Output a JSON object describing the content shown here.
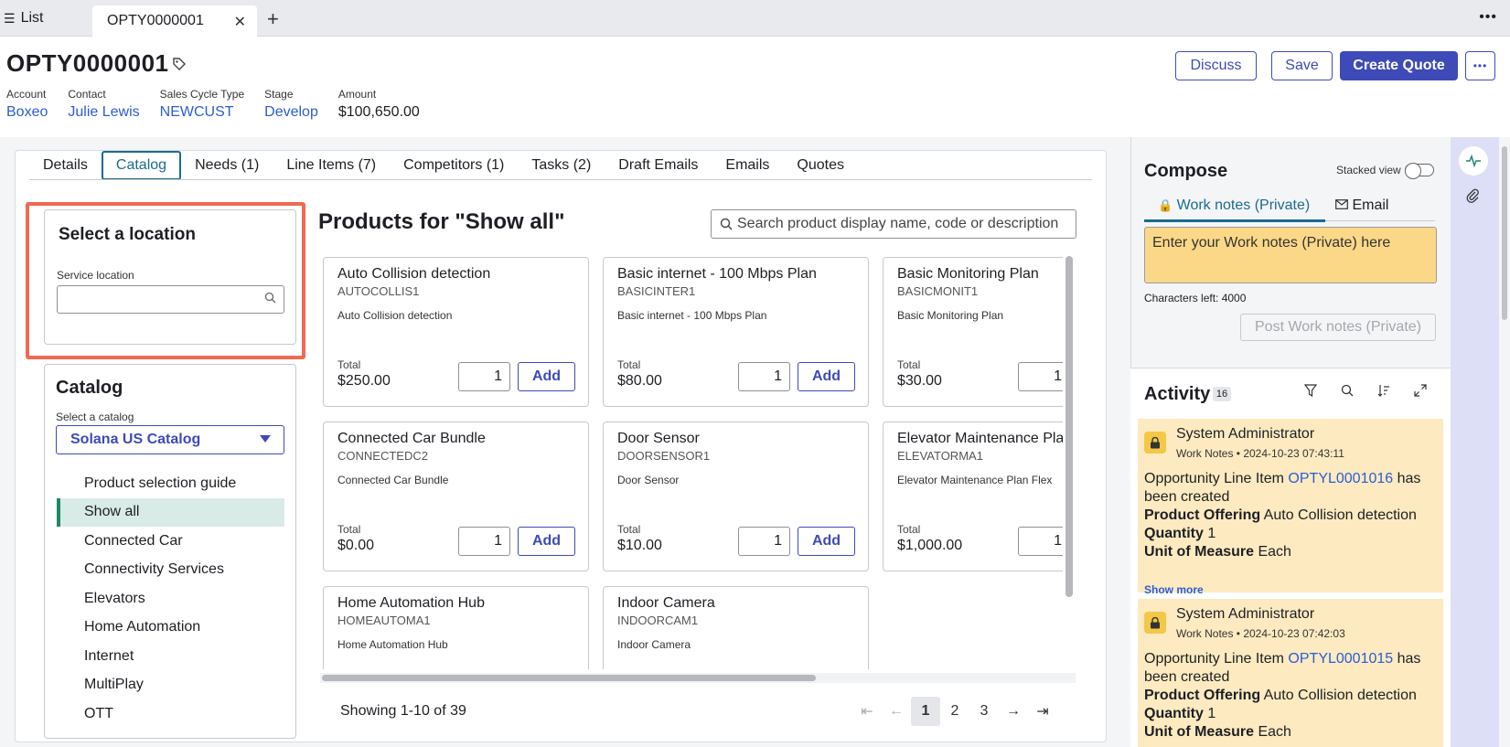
{
  "tabs": {
    "list_label": "List",
    "active_label": "OPTY0000001",
    "close_symbol": "✕",
    "plus_symbol": "+",
    "more_symbol": "•••"
  },
  "header": {
    "title": "OPTY0000001",
    "fields": [
      {
        "label": "Account",
        "value": "Boxeo"
      },
      {
        "label": "Contact",
        "value": "Julie Lewis"
      },
      {
        "label": "Sales Cycle Type",
        "value": "NEWCUST"
      },
      {
        "label": "Stage",
        "value": "Develop"
      },
      {
        "label": "Amount",
        "value": "$100,650.00"
      }
    ],
    "discuss_label": "Discuss",
    "save_label": "Save",
    "create_quote_label": "Create Quote",
    "more_label": "•••"
  },
  "subtabs": [
    "Details",
    "Catalog",
    "Needs (1)",
    "Line Items (7)",
    "Competitors (1)",
    "Tasks (2)",
    "Draft Emails",
    "Emails",
    "Quotes"
  ],
  "location": {
    "title": "Select a location",
    "field_label": "Service location",
    "value": ""
  },
  "catalog": {
    "title": "Catalog",
    "select_label": "Select a catalog",
    "selected": "Solana US Catalog",
    "items": [
      "Product selection guide",
      "Show all",
      "Connected Car",
      "Connectivity Services",
      "Elevators",
      "Home Automation",
      "Internet",
      "MultiPlay",
      "OTT"
    ],
    "active_index": 1
  },
  "products": {
    "title": "Products for \"Show all\"",
    "search_placeholder": "Search product display name, code or description",
    "total_label": "Total",
    "add_label": "Add",
    "items": [
      {
        "name": "Auto Collision detection",
        "code": "AUTOCOLLIS1",
        "desc": "Auto Collision detection",
        "price": "$250.00",
        "qty": "1"
      },
      {
        "name": "Basic internet - 100 Mbps Plan",
        "code": "BASICINTER1",
        "desc": "Basic internet - 100 Mbps Plan",
        "price": "$80.00",
        "qty": "1"
      },
      {
        "name": "Basic Monitoring Plan",
        "code": "BASICMONIT1",
        "desc": "Basic Monitoring Plan",
        "price": "$30.00",
        "qty": "1"
      },
      {
        "name": "Connected Car Bundle",
        "code": "CONNECTEDC2",
        "desc": "Connected Car Bundle",
        "price": "$0.00",
        "qty": "1"
      },
      {
        "name": "Door Sensor",
        "code": "DOORSENSOR1",
        "desc": "Door Sensor",
        "price": "$10.00",
        "qty": "1"
      },
      {
        "name": "Elevator Maintenance Plan",
        "code": "ELEVATORMA1",
        "desc": "Elevator Maintenance Plan Flex",
        "price": "$1,000.00",
        "qty": "1"
      },
      {
        "name": "Home Automation Hub",
        "code": "HOMEAUTOMA1",
        "desc": "Home Automation Hub",
        "price": "",
        "qty": ""
      },
      {
        "name": "Indoor Camera",
        "code": "INDOORCAM1",
        "desc": "Indoor Camera",
        "price": "",
        "qty": ""
      }
    ],
    "showing": "Showing 1-10 of 39",
    "pages": [
      "1",
      "2",
      "3"
    ],
    "current_page": "1"
  },
  "compose": {
    "title": "Compose",
    "stacked_label": "Stacked view",
    "tab_worknotes": "Work notes (Private)",
    "tab_email": "Email",
    "placeholder": "Enter your Work notes (Private) here",
    "chars_left": "Characters left: 4000",
    "post_label": "Post Work notes (Private)"
  },
  "activity": {
    "title": "Activity",
    "count": "16",
    "show_more": "Show more",
    "entries": [
      {
        "author": "System Administrator",
        "meta": "Work Notes • 2024-10-23 07:43:11",
        "line_prefix": "Opportunity Line Item ",
        "link": "OPTYL0001016",
        "line_suffix": " has been created",
        "po_label": "Product Offering",
        "po_value": "Auto Collision detection",
        "qty_label": "Quantity",
        "qty_value": "1",
        "uom_label": "Unit of Measure",
        "uom_value": "Each"
      },
      {
        "author": "System Administrator",
        "meta": "Work Notes • 2024-10-23 07:42:03",
        "line_prefix": "Opportunity Line Item ",
        "link": "OPTYL0001015",
        "line_suffix": " has been created",
        "po_label": "Product Offering",
        "po_value": "Auto Collision detection",
        "qty_label": "Quantity",
        "qty_value": "1",
        "uom_label": "Unit of Measure",
        "uom_value": "Each"
      }
    ]
  },
  "colors": {
    "accent": "#3e4ab8",
    "link": "#2b5cd6",
    "highlight": "#f06a52",
    "worknote": "#fbd888"
  }
}
